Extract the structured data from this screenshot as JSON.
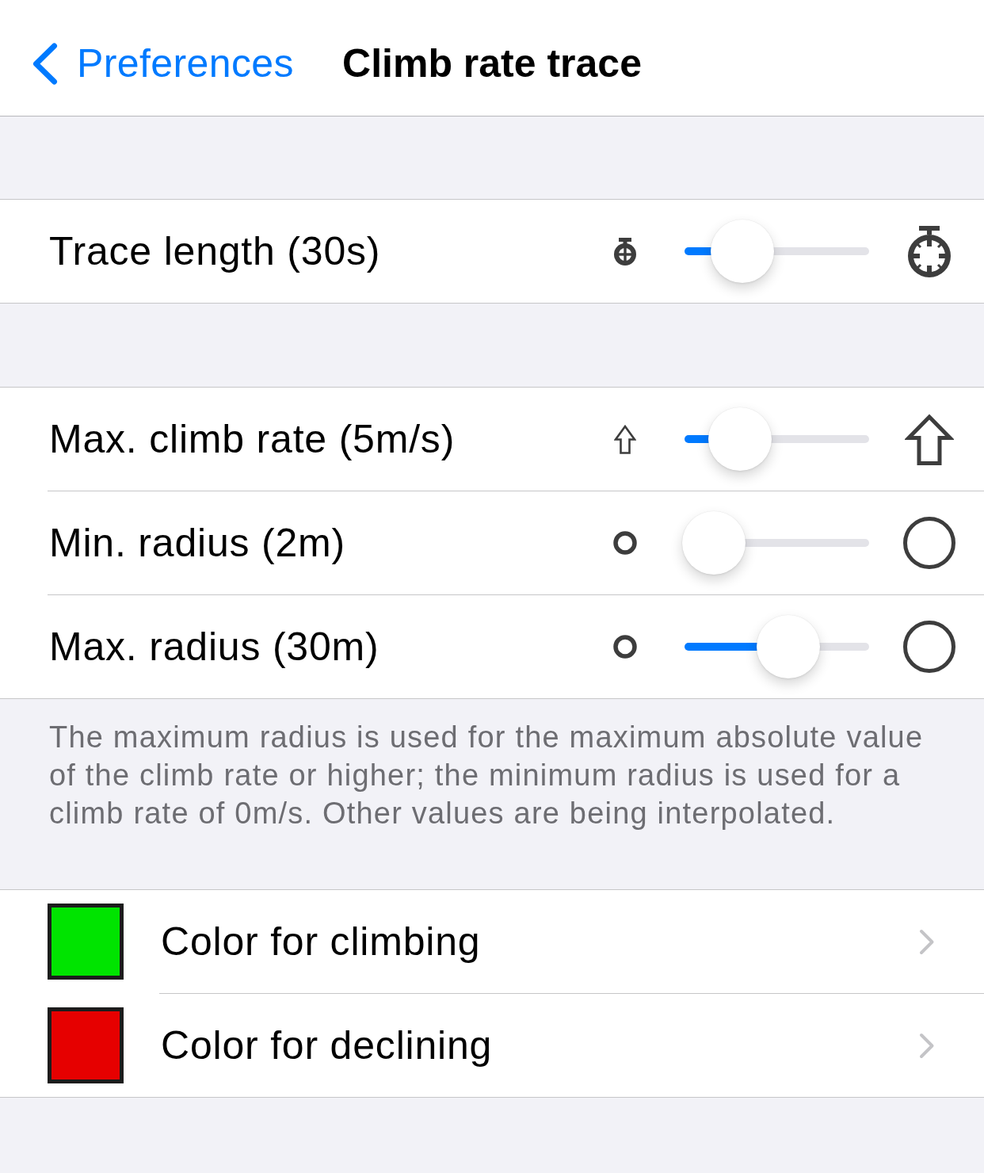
{
  "nav_bar": {
    "back": "Preferences",
    "title": "Climb rate trace"
  },
  "sections": [
    {
      "rows": [
        {
          "kind": "timer",
          "label": "Trace length (30s)",
          "level": 0.23
        }
      ]
    },
    {
      "rows": [
        {
          "kind": "climb",
          "label": "Max. climb rate (5m/s)",
          "level": 0.21
        },
        {
          "kind": "radius",
          "label": "Min. radius (2m)",
          "level": 0
        },
        {
          "kind": "radius",
          "label": "Max. radius (30m)",
          "level": 0.6
        }
      ],
      "footer": "The maximum radius is used for the maximum absolute value of the climb rate or higher; the minimum radius is used for a climb rate of 0m/s. Other values are being interpolated."
    },
    {
      "rows": [
        {
          "kind": "color",
          "label": "Color for climbing",
          "color": "#00e400"
        },
        {
          "kind": "color",
          "label": "Color for declining",
          "color": "#e60000"
        }
      ]
    }
  ]
}
